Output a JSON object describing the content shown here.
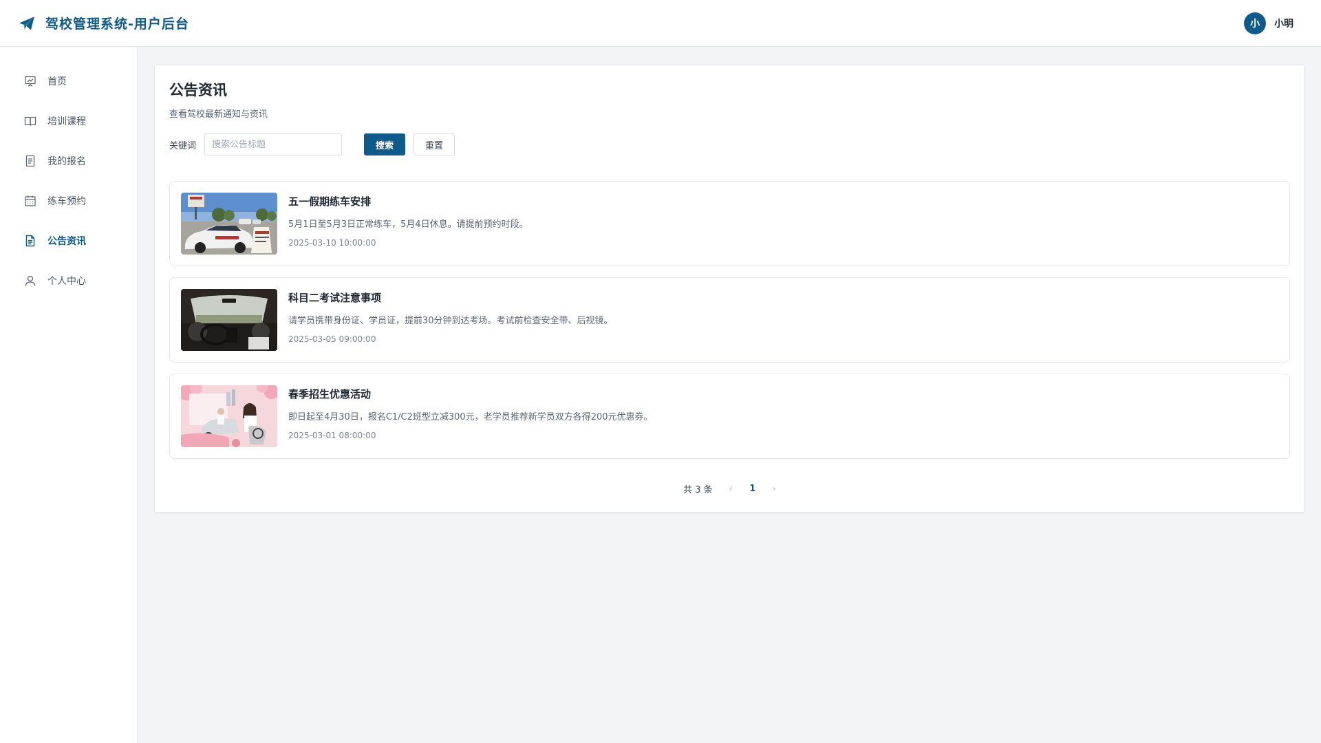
{
  "header": {
    "app_title": "驾校管理系统-用户后台",
    "user": {
      "avatar_text": "小",
      "name": "小明"
    }
  },
  "sidebar": {
    "items": [
      {
        "label": "首页",
        "icon": "presentation-icon",
        "active": false
      },
      {
        "label": "培训课程",
        "icon": "book-icon",
        "active": false
      },
      {
        "label": "我的报名",
        "icon": "document-list-icon",
        "active": false
      },
      {
        "label": "练车预约",
        "icon": "calendar-icon",
        "active": false
      },
      {
        "label": "公告资讯",
        "icon": "document-text-icon",
        "active": true
      },
      {
        "label": "个人中心",
        "icon": "user-icon",
        "active": false
      }
    ]
  },
  "main": {
    "title": "公告资讯",
    "subtitle": "查看驾校最新通知与资讯",
    "search": {
      "label": "关键词",
      "value": "",
      "placeholder": "搜索公告标题",
      "search_button": "搜索",
      "reset_button": "重置"
    },
    "announcements": [
      {
        "title": "五一假期练车安排",
        "description": "5月1日至5月3日正常练车，5月4日休息。请提前预约时段。",
        "date": "2025-03-10 10:00:00"
      },
      {
        "title": "科目二考试注意事项",
        "description": "请学员携带身份证、学员证，提前30分钟到达考场。考试前检查安全带、后视镜。",
        "date": "2025-03-05 09:00:00"
      },
      {
        "title": "春季招生优惠活动",
        "description": "即日起至4月30日，报名C1/C2班型立减300元，老学员推荐新学员双方各得200元优惠券。",
        "date": "2025-03-01 08:00:00"
      }
    ],
    "pagination": {
      "total_text": "共 3 条",
      "current_page": "1",
      "prev": "‹",
      "next": "›"
    }
  },
  "colors": {
    "brand": "#0e5a8a",
    "background": "#f3f4f7",
    "card": "#ffffff"
  }
}
